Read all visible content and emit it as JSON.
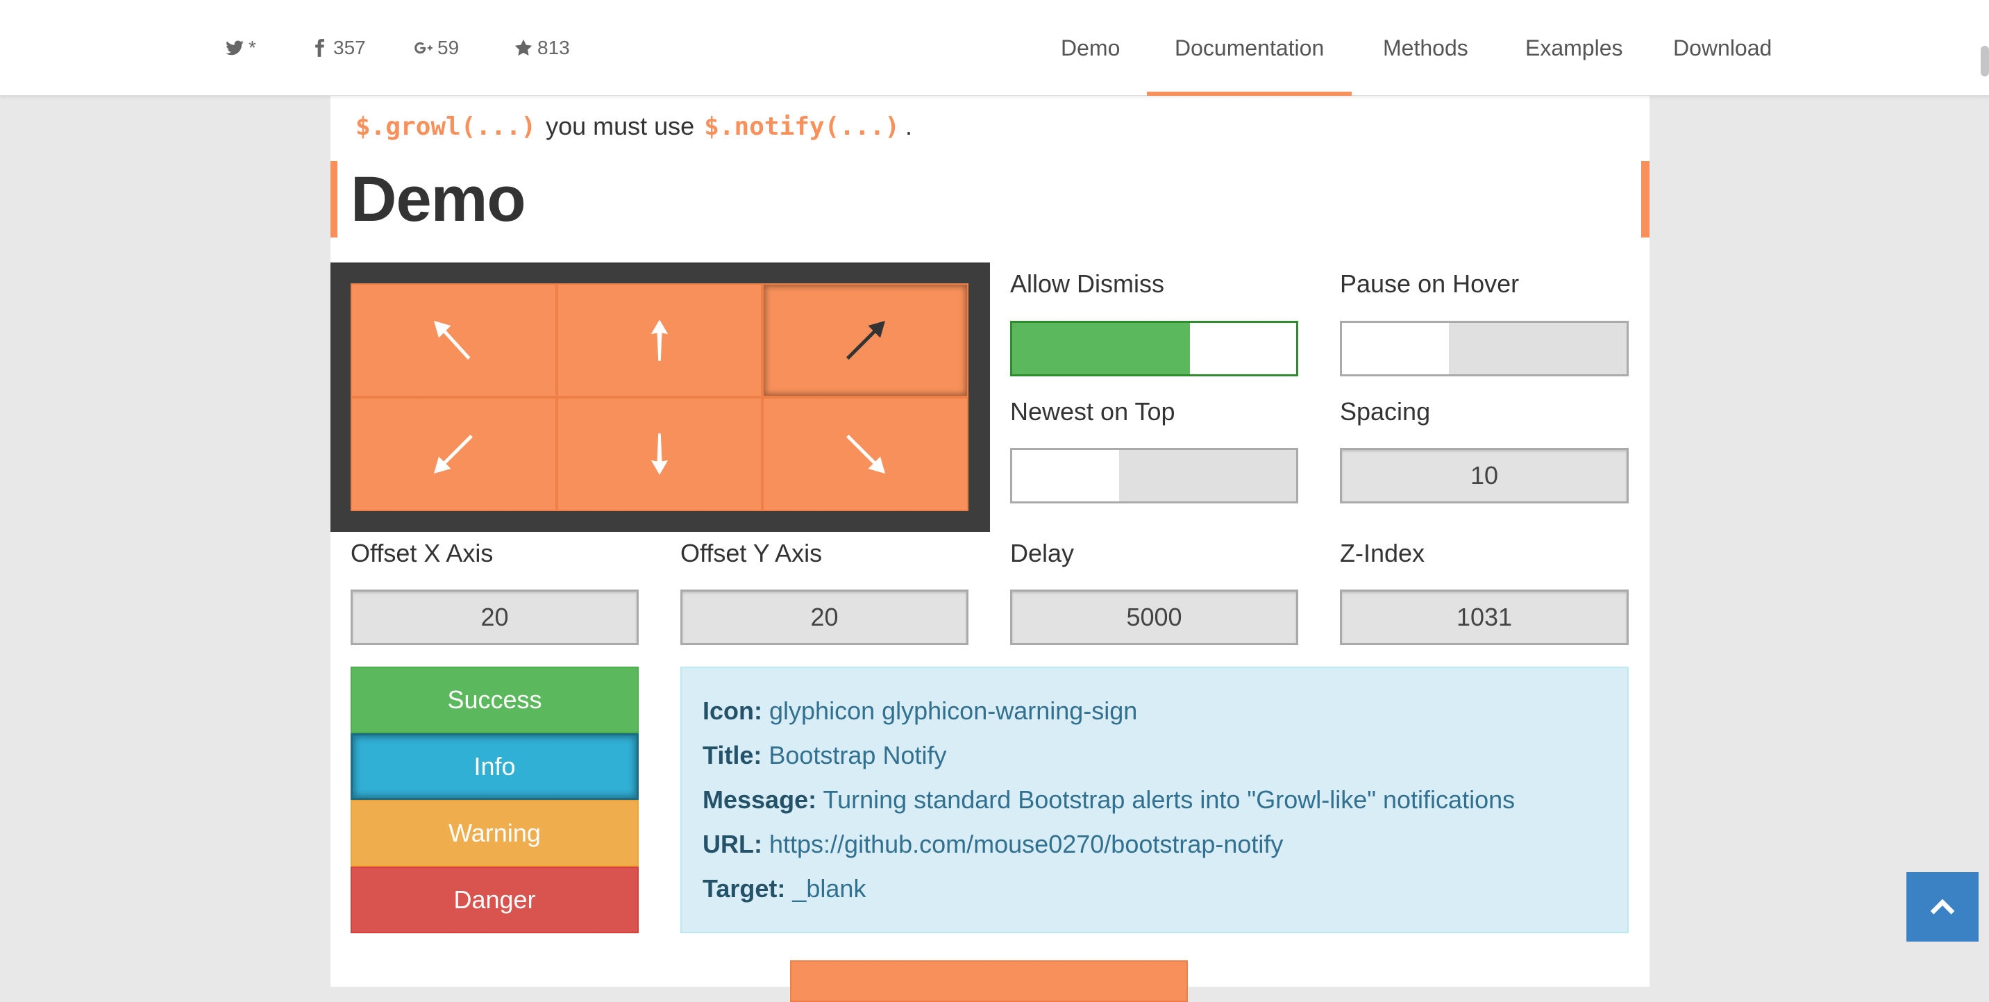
{
  "nav": {
    "social": {
      "twitter": "*",
      "facebook": "357",
      "gplus": "59",
      "star": "813"
    },
    "links": [
      "Demo",
      "Documentation",
      "Methods",
      "Examples",
      "Download"
    ],
    "active": "Documentation"
  },
  "intro": {
    "code1": "$.growl(...)",
    "middle": "you must use",
    "code2": "$.notify(...)",
    "end": "."
  },
  "heading": "Demo",
  "grid": {
    "cells": [
      {
        "name": "top-left",
        "icon": "arrow-up-left-icon",
        "selected": false
      },
      {
        "name": "top-center",
        "icon": "arrow-up-icon",
        "selected": false
      },
      {
        "name": "top-right",
        "icon": "arrow-up-right-icon",
        "selected": true
      },
      {
        "name": "bottom-left",
        "icon": "arrow-down-left-icon",
        "selected": false
      },
      {
        "name": "bottom-center",
        "icon": "arrow-down-icon",
        "selected": false
      },
      {
        "name": "bottom-right",
        "icon": "arrow-down-right-icon",
        "selected": false
      }
    ]
  },
  "settings": {
    "allow_dismiss": {
      "label": "Allow Dismiss",
      "on": true
    },
    "pause_on_hover": {
      "label": "Pause on Hover",
      "on": false
    },
    "newest_on_top": {
      "label": "Newest on Top",
      "on": false
    },
    "spacing": {
      "label": "Spacing",
      "value": "10"
    },
    "offset_x": {
      "label": "Offset X Axis",
      "value": "20"
    },
    "offset_y": {
      "label": "Offset Y Axis",
      "value": "20"
    },
    "delay": {
      "label": "Delay",
      "value": "5000"
    },
    "z_index": {
      "label": "Z-Index",
      "value": "1031"
    }
  },
  "types": {
    "success": "Success",
    "info": "Info",
    "warning": "Warning",
    "danger": "Danger",
    "selected": "Info"
  },
  "info": {
    "icon_label": "Icon:",
    "icon_value": "glyphicon glyphicon-warning-sign",
    "title_label": "Title:",
    "title_value": "Bootstrap Notify",
    "message_label": "Message:",
    "message_value": "Turning standard Bootstrap alerts into \"Growl-like\" notifications",
    "url_label": "URL:",
    "url_value": "https://github.com/mouse0270/bootstrap-notify",
    "target_label": "Target:",
    "target_value": "_blank"
  },
  "colors": {
    "accent": "#f7905a",
    "success": "#5cb85c",
    "info": "#31b0d5",
    "warning": "#f0ad4e",
    "danger": "#d9534f",
    "back_to_top": "#3b82c4"
  }
}
